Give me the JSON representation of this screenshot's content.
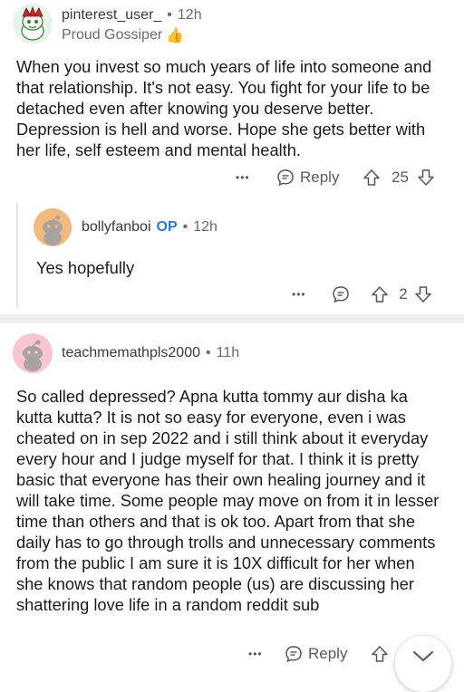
{
  "comments": [
    {
      "username": "pinterest_user_",
      "time": "12h",
      "flair": "Proud Gossiper",
      "flair_emoji": "👍",
      "text": "When you invest so much years of life into someone and that relationship. It's not easy. You fight for your life to be detached even after knowing you deserve better. Depression is hell and worse. Hope she gets better with her life, self esteem and mental health.",
      "reply_label": "Reply",
      "score": "25"
    },
    {
      "username": "bollyfanboi",
      "op_badge": "OP",
      "time": "12h",
      "text": "Yes hopefully",
      "score": "2"
    },
    {
      "username": "teachmemathpls2000",
      "time": "11h",
      "text": "So called depressed? Apna kutta tommy aur disha ka kutta kutta? It is not so easy for everyone, even i was cheated on in sep 2022 and i still think about it everyday every hour and I judge myself for that. I think it is pretty basic that everyone has their own healing journey and it will take time. Some people may move on from it in lesser time than others and that is ok too. Apart from that she daily has to go through trolls and unnecessary comments from the public I am sure it is 10X difficult for her when she knows that random people (us) are discussing her shattering love life in a random reddit sub",
      "reply_label": "Reply"
    }
  ],
  "separator": "•",
  "more_label": "•••",
  "colors": {
    "op_blue": "#2a7bd8",
    "divider": "#edeff1"
  },
  "icons": [
    "more-icon",
    "reply-bubble-icon",
    "upvote-icon",
    "downvote-icon",
    "collapse-chevron-icon"
  ]
}
